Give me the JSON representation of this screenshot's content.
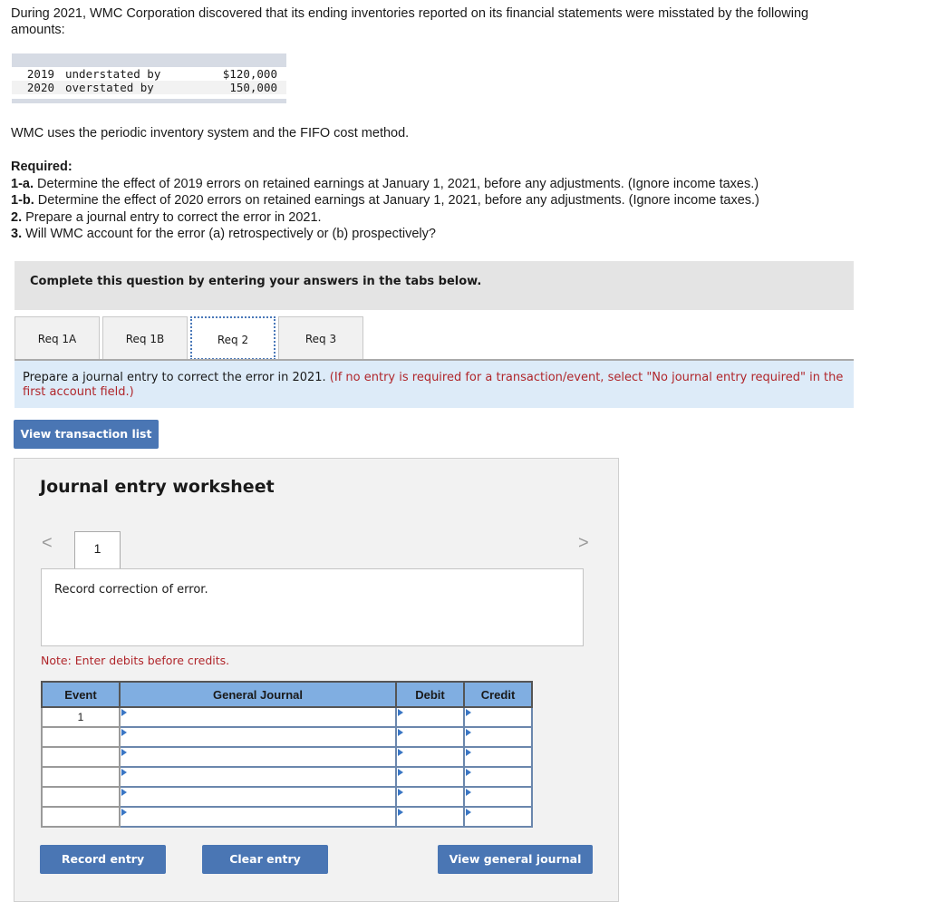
{
  "intro": "During 2021, WMC Corporation discovered that its ending inventories reported on its financial statements were misstated by the following amounts:",
  "misstatements": [
    {
      "year": "2019",
      "desc": "understated by",
      "amount": "$120,000"
    },
    {
      "year": "2020",
      "desc": "overstated by",
      "amount": "150,000"
    }
  ],
  "uses": "WMC uses the periodic inventory system and the FIFO cost method.",
  "required": {
    "heading": "Required:",
    "items": [
      {
        "label": "1-a.",
        "text": " Determine the effect of 2019 errors on retained earnings at January 1, 2021, before any adjustments. (Ignore income taxes.)"
      },
      {
        "label": "1-b.",
        "text": " Determine the effect of 2020 errors on retained earnings at January 1, 2021, before any adjustments. (Ignore income taxes.)"
      },
      {
        "label": "2.",
        "text": " Prepare a journal entry to correct the error in 2021."
      },
      {
        "label": "3.",
        "text": " Will WMC account for the error (a) retrospectively or (b) prospectively?"
      }
    ]
  },
  "complete_banner": "Complete this question by entering your answers in the tabs below.",
  "tabs": [
    {
      "label": "Req 1A",
      "active": false
    },
    {
      "label": "Req 1B",
      "active": false
    },
    {
      "label": "Req 2",
      "active": true
    },
    {
      "label": "Req 3",
      "active": false
    }
  ],
  "instruction": {
    "main": "Prepare a journal entry to correct the error in 2021. ",
    "note": "(If no entry is required for a transaction/event, select \"No journal entry required\" in the first account field.)"
  },
  "view_transaction_list": "View transaction list",
  "worksheet": {
    "title": "Journal entry worksheet",
    "page": "1",
    "prev_icon": "<",
    "next_icon": ">",
    "description": "Record correction of error.",
    "note": "Note: Enter debits before credits.",
    "columns": [
      "Event",
      "General Journal",
      "Debit",
      "Credit"
    ],
    "rows": [
      {
        "event": "1",
        "account": "",
        "debit": "",
        "credit": ""
      },
      {
        "event": "",
        "account": "",
        "debit": "",
        "credit": ""
      },
      {
        "event": "",
        "account": "",
        "debit": "",
        "credit": ""
      },
      {
        "event": "",
        "account": "",
        "debit": "",
        "credit": ""
      },
      {
        "event": "",
        "account": "",
        "debit": "",
        "credit": ""
      },
      {
        "event": "",
        "account": "",
        "debit": "",
        "credit": ""
      }
    ],
    "buttons": {
      "record": "Record entry",
      "clear": "Clear entry",
      "view_journal": "View general journal"
    }
  }
}
